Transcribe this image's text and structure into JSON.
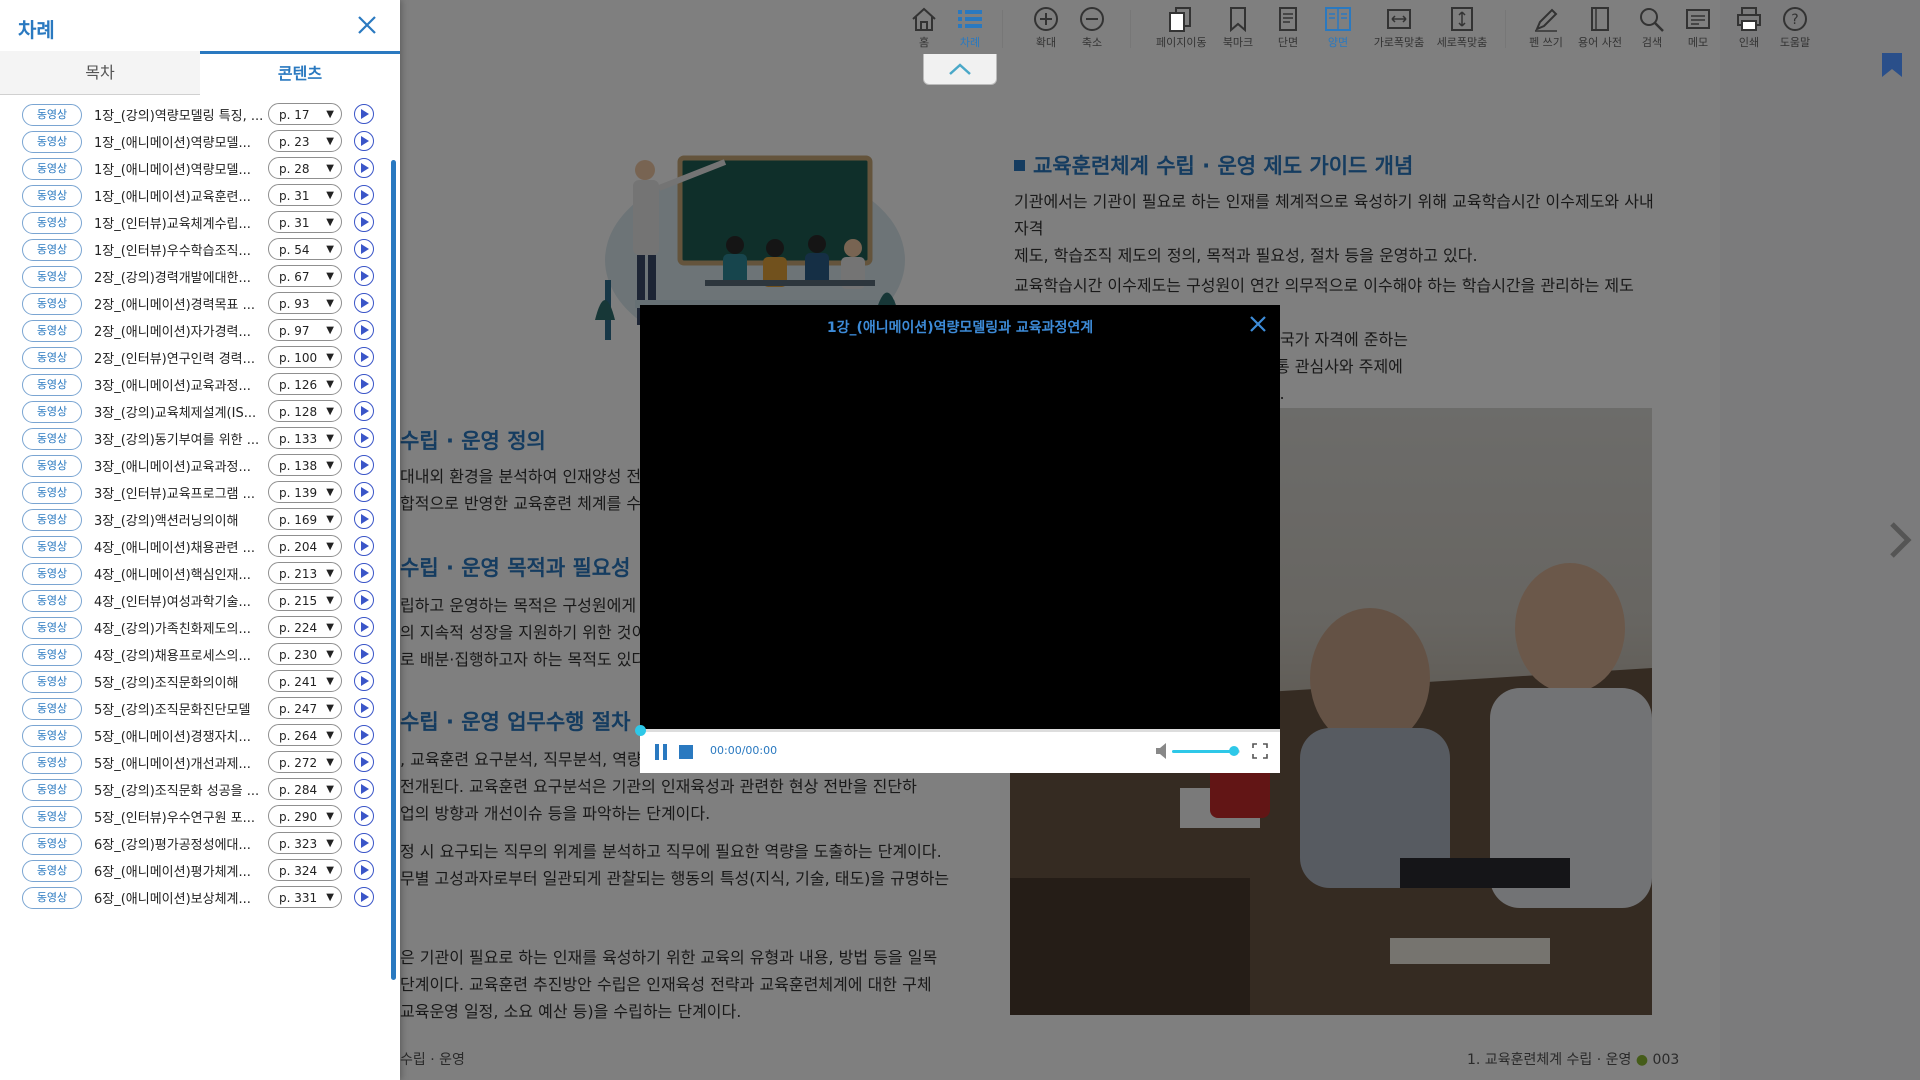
{
  "toolbar": {
    "items": [
      {
        "label": "홈",
        "icon": "home-icon"
      },
      {
        "label": "차례",
        "icon": "list-icon",
        "active": true
      },
      {
        "label": "확대",
        "icon": "zoom-in-icon"
      },
      {
        "label": "축소",
        "icon": "zoom-out-icon"
      },
      {
        "label": "페이지이동",
        "icon": "page-move-icon"
      },
      {
        "label": "북마크",
        "icon": "bookmark-icon"
      },
      {
        "label": "단면",
        "icon": "single-page-icon"
      },
      {
        "label": "양면",
        "icon": "double-page-icon",
        "active": true
      },
      {
        "label": "가로폭맞춤",
        "icon": "fit-width-icon"
      },
      {
        "label": "세로폭맞춤",
        "icon": "fit-height-icon"
      },
      {
        "label": "펜 쓰기",
        "icon": "pen-icon"
      },
      {
        "label": "용어 사전",
        "icon": "dictionary-icon"
      },
      {
        "label": "검색",
        "icon": "search-icon"
      },
      {
        "label": "메모",
        "icon": "memo-icon"
      },
      {
        "label": "인쇄",
        "icon": "print-icon"
      },
      {
        "label": "도움말",
        "icon": "help-icon"
      }
    ],
    "accent": "#2a79c0"
  },
  "sidebar": {
    "title": "차례",
    "tabs": [
      {
        "label": "목차",
        "active": false
      },
      {
        "label": "콘텐츠",
        "active": true
      }
    ],
    "badge_label": "동영상",
    "items": [
      {
        "title": "1장_(강의)역량모델링 특징, ...",
        "page": "p. 17"
      },
      {
        "title": "1장_(애니메이션)역량모델...",
        "page": "p. 23"
      },
      {
        "title": "1장_(애니메이션)역량모델...",
        "page": "p. 28"
      },
      {
        "title": "1장_(애니메이션)교육훈련...",
        "page": "p. 31"
      },
      {
        "title": "1장_(인터뷰)교육체계수립...",
        "page": "p. 31"
      },
      {
        "title": "1장_(인터뷰)우수학습조직...",
        "page": "p. 54"
      },
      {
        "title": "2장_(강의)경력개발에대한...",
        "page": "p. 67"
      },
      {
        "title": "2장_(애니메이션)경력목표 ...",
        "page": "p. 93"
      },
      {
        "title": "2장_(애니메이션)자가경력...",
        "page": "p. 97"
      },
      {
        "title": "2장_(인터뷰)연구인력 경력...",
        "page": "p. 100"
      },
      {
        "title": "3장_(애니메이션)교육과정...",
        "page": "p. 126"
      },
      {
        "title": "3장_(강의)교육체제설계(IS...",
        "page": "p. 128"
      },
      {
        "title": "3장_(강의)동기부여를 위한 ...",
        "page": "p. 133"
      },
      {
        "title": "3장_(애니메이션)교육과정...",
        "page": "p. 138"
      },
      {
        "title": "3장_(인터뷰)교육프로그램 ...",
        "page": "p. 139"
      },
      {
        "title": "3장_(강의)액션러닝의이해",
        "page": "p. 169"
      },
      {
        "title": "4장_(애니메이션)채용관련 ...",
        "page": "p. 204"
      },
      {
        "title": "4장_(애니메이션)핵심인재...",
        "page": "p. 213"
      },
      {
        "title": "4장_(인터뷰)여성과학기술...",
        "page": "p. 215"
      },
      {
        "title": "4장_(강의)가족친화제도의...",
        "page": "p. 224"
      },
      {
        "title": "4장_(강의)채용프로세스의...",
        "page": "p. 230"
      },
      {
        "title": "5장_(강의)조직문화의이해",
        "page": "p. 241"
      },
      {
        "title": "5장_(강의)조직문화진단모델",
        "page": "p. 247"
      },
      {
        "title": "5장_(애니메이션)경쟁자치...",
        "page": "p. 264"
      },
      {
        "title": "5장_(애니메이션)개선과제...",
        "page": "p. 272"
      },
      {
        "title": "5장_(강의)조직문화 성공을 ...",
        "page": "p. 284"
      },
      {
        "title": "5장_(인터뷰)우수연구원 포...",
        "page": "p. 290"
      },
      {
        "title": "6장_(강의)평가공정성에대...",
        "page": "p. 323"
      },
      {
        "title": "6장_(애니메이션)평가체계...",
        "page": "p. 324"
      },
      {
        "title": "6장_(애니메이션)보상체계...",
        "page": "p. 331"
      }
    ]
  },
  "book": {
    "left": {
      "headings": [
        "수립 · 운영 정의",
        "수립 · 운영 목적과 필요성",
        "수립 · 운영 업무수행 절차"
      ],
      "para1": "대내외 환경을 분석하여 인재양성 전략\n합적으로 반영한 교육훈련 체계를 수립",
      "para2": "립하고 운영하는 목적은 구성원에게 기관\n의 지속적 성장을 지원하기 위한 것이다\n로 배분·집행하고자 하는 목적도 있다.",
      "para3": ", 교육훈련 요구분석, 직무분석, 역량모\n전개된다.  교육훈련 요구분석은 기관의 인재육성과 관련한 현상 전반을 진단하\n업의 방향과 개선이슈 등을 파악하는 단계이다.",
      "para4": "정 시 요구되는 직무의 위계를 분석하고 직무에 필요한 역량을 도출하는 단계이다.\n무별 고성과자로부터 일관되게 관찰되는 행동의 특성(지식, 기술, 태도)을 규명하는",
      "para5": "은 기관이 필요로 하는 인재를 육성하기 위한 교육의 유형과 내용, 방법 등을 일목\n단계이다.  교육훈련 추진방안 수립은 인재육성 전략과 교육훈련체계에 대한 구체\n교육운영 일정, 소요 예산 등)을 수립하는 단계이다.",
      "footer": "수립 · 운영"
    },
    "right": {
      "heading": "교육훈련체계 수립 · 운영 제도 가이드 개념",
      "para1": "기관에서는 기관이 필요로 하는 인재를 체계적으로 육성하기 위해 교육학습시간 이수제도와 사내자격\n제도, 학습조직 제도의 정의, 목적과 필요성, 절차 등을 운영하고 있다.",
      "para2": "교육학습시간 이수제도는 구성원이 연간 의무적으로 이수해야 하는 학습시간을 관리하는 제도(교육,\n                                                              성에 맞는 자격을 개발하고, 정부로부터 국가 자격에 준하는\n                                                              조직 제도는 직무나 전문지식에 관한 공통 관심사와 주제에\n                                                              향시키는 학습그룹을 지원하는 제도이다.",
      "footer_text": "1. 교육훈련체계 수립 · 운영",
      "footer_page": "003"
    }
  },
  "video": {
    "title": "1강_(애니메이션)역량모델링과 교육과정연계",
    "time": "00:00/00:00",
    "progress": 0,
    "volume": 0.9
  }
}
